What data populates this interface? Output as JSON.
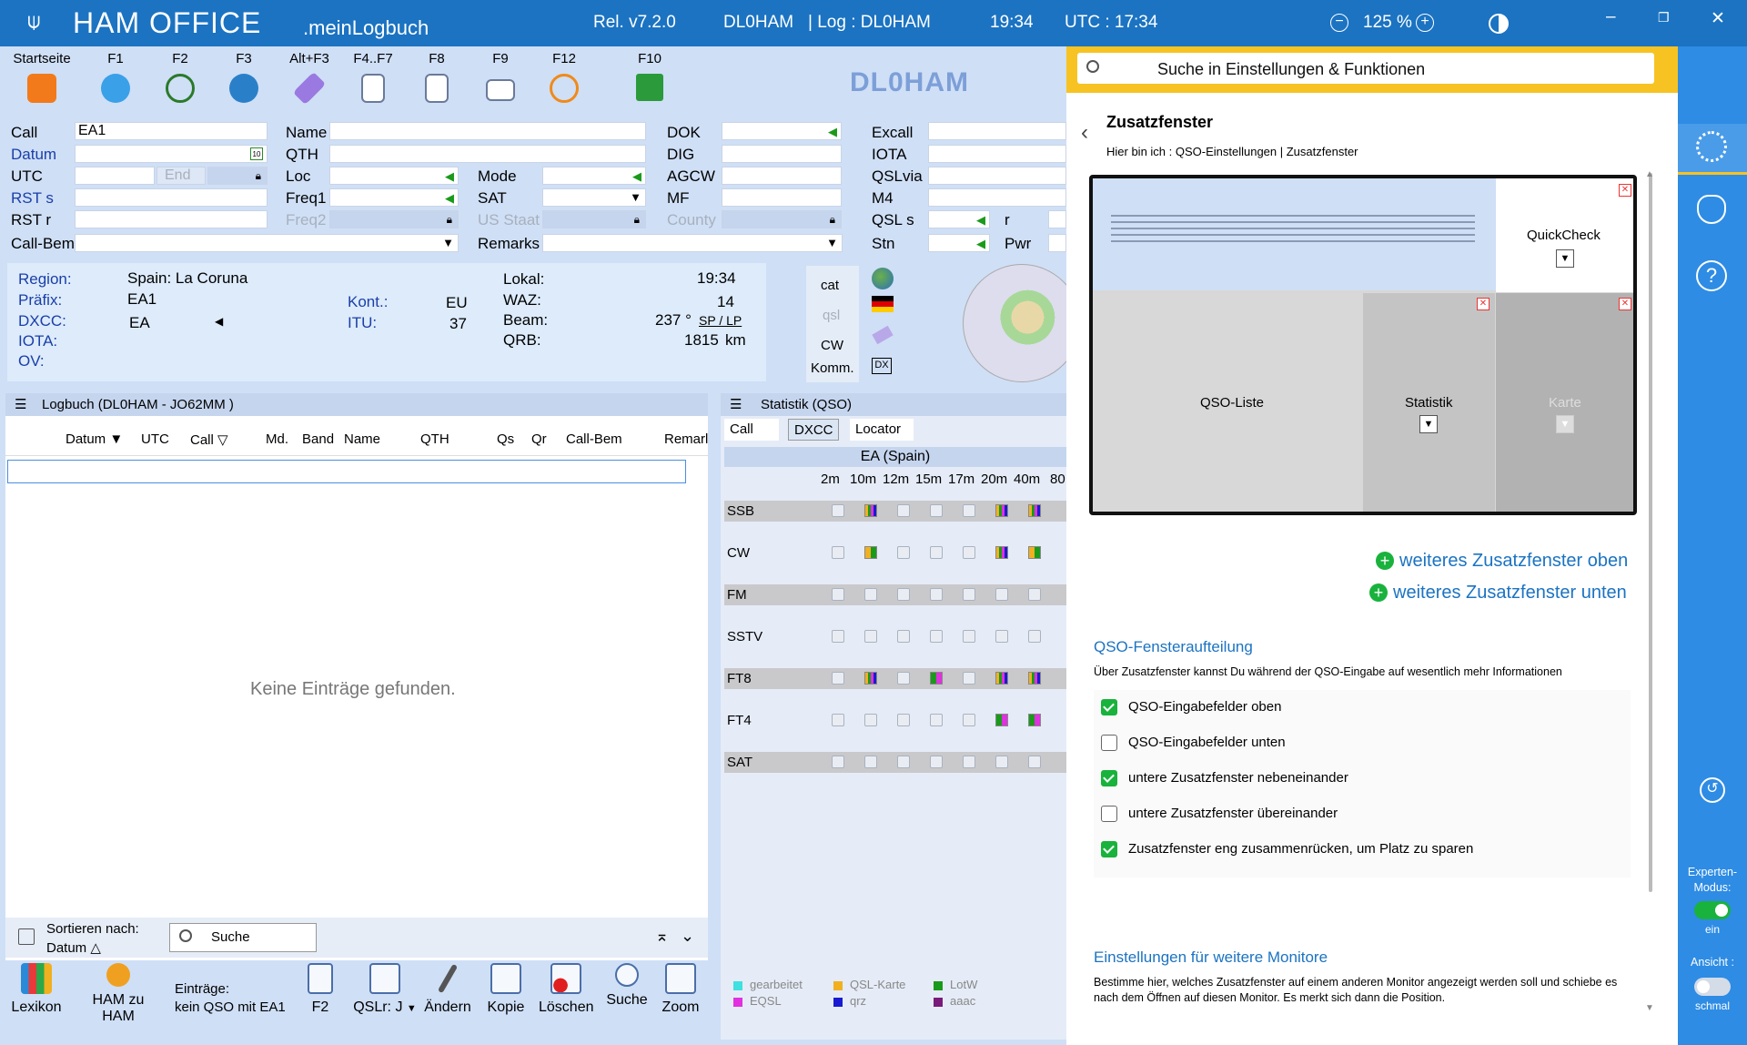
{
  "titlebar": {
    "app": "HAM OFFICE",
    "app_sub": ".meinLogbuch",
    "release": "Rel. v7.2.0",
    "station": "DL0HAM",
    "log": "|   Log : DL0HAM",
    "time": "19:34",
    "utc": "UTC : 17:34",
    "zoom": "125 %"
  },
  "toolbar": {
    "items": [
      {
        "key": "Startseite",
        "icon": "home-icon",
        "color": "#f27a1a"
      },
      {
        "key": "F1",
        "icon": "help-icon",
        "color": "#3aa0e8"
      },
      {
        "key": "F2",
        "icon": "clock-calendar-icon",
        "color": "#2a7a2a"
      },
      {
        "key": "F3",
        "icon": "globe-icon",
        "color": "#2a80c8"
      },
      {
        "key": "Alt+F3",
        "icon": "satellite-icon",
        "color": "#8a6ad0"
      },
      {
        "key": "F4..F7",
        "icon": "document-icon",
        "color": "#e07a2a"
      },
      {
        "key": "F8",
        "icon": "info-doc-icon",
        "color": "#3a8ad8"
      },
      {
        "key": "F9",
        "icon": "mail-plus-icon",
        "color": "#2aaa4a"
      },
      {
        "key": "F12",
        "icon": "sync-icon",
        "color": "#f08a1a"
      },
      {
        "key": "F10",
        "icon": "save-icon",
        "color": "#2a9a3a"
      }
    ],
    "callsign": "DL0HAM"
  },
  "form": {
    "call_label": "Call",
    "call_value": "EA1",
    "datum_label": "Datum",
    "utc_label": "UTC",
    "utc_end": "End",
    "rsts_label": "RST s",
    "rstr_label": "RST r",
    "callbem_label": "Call-Bem.",
    "name_label": "Name",
    "qth_label": "QTH",
    "loc_label": "Loc",
    "freq1_label": "Freq1",
    "freq2_label": "Freq2",
    "mode_label": "Mode",
    "sat_label": "SAT",
    "usstaat_label": "US Staat",
    "remarks_label": "Remarks",
    "dok_label": "DOK",
    "dig_label": "DIG",
    "agcw_label": "AGCW",
    "mf_label": "MF",
    "county_label": "County",
    "excall_label": "Excall",
    "iota_label": "IOTA",
    "qslvia_label": "QSLvia",
    "m4_label": "M4",
    "qsls_label": "QSL s",
    "r_label": "r",
    "stn_label": "Stn",
    "pwr_label": "Pwr"
  },
  "info": {
    "region_label": "Region:",
    "region": "Spain: La Coruna",
    "praefix_label": "Präfix:",
    "praefix": "EA1",
    "dxcc_label": "DXCC:",
    "dxcc": "EA",
    "iota_label": "IOTA:",
    "ov_label": "OV:",
    "kont_label": "Kont.:",
    "kont": "EU",
    "itu_label": "ITU:",
    "itu": "37",
    "lokal_label": "Lokal:",
    "lokal": "19:34",
    "waz_label": "WAZ:",
    "waz": "14",
    "beam_label": "Beam:",
    "beam": "237 °",
    "splp": "SP / LP",
    "qrb_label": "QRB:",
    "qrb": "1815",
    "qrb_unit": "km",
    "side": [
      "cat",
      "qsl",
      "CW",
      "Komm."
    ]
  },
  "logbook": {
    "title": "Logbuch  (DL0HAM - JO62MM )",
    "columns": [
      "Datum",
      "UTC",
      "Call",
      "Md.",
      "Band",
      "Name",
      "QTH",
      "Qs",
      "Qr",
      "Call-Bem",
      "Remarl"
    ],
    "empty": "Keine Einträge gefunden.",
    "sort_label": "Sortieren nach:",
    "sort_value": "Datum △",
    "search_placeholder": "Suche"
  },
  "stats": {
    "title": "Statistik (QSO)",
    "tabs": [
      "Call",
      "DXCC",
      "Locator"
    ],
    "country": "EA (Spain)",
    "bands": [
      "2m",
      "10m",
      "12m",
      "15m",
      "17m",
      "20m",
      "40m",
      "80"
    ],
    "modes": [
      "SSB",
      "CW",
      "FM",
      "SSTV",
      "FT8",
      "FT4",
      "SAT"
    ],
    "legend": [
      {
        "label": "gearbeitet",
        "color": "#3ee0e0"
      },
      {
        "label": "QSL-Karte",
        "color": "#f0b020"
      },
      {
        "label": "LotW",
        "color": "#1a9a1a"
      },
      {
        "label": "EQSL",
        "color": "#e030e0"
      },
      {
        "label": "qrz",
        "color": "#1a1ad0"
      },
      {
        "label": "aaac",
        "color": "#7a1a7a"
      }
    ]
  },
  "bottombar": {
    "lexikon": "Lexikon",
    "hamzuham": "HAM zu HAM",
    "eintraege_label": "Einträge:",
    "eintraege_value": "kein QSO mit EA1",
    "f2": "F2",
    "qslr": "QSLr: J",
    "aendern": "Ändern",
    "kopie": "Kopie",
    "loeschen": "Löschen",
    "suche": "Suche",
    "zoom": "Zoom"
  },
  "settings": {
    "search_placeholder": "Suche in Einstellungen & Funktionen",
    "title": "Zusatzfenster",
    "breadcrumb": "Hier bin ich : QSO-Einstellungen | Zusatzfenster",
    "preview": {
      "quickcheck": "QuickCheck",
      "qsoliste": "QSO-Liste",
      "statistik": "Statistik",
      "karte": "Karte"
    },
    "add_top": "weiteres Zusatzfenster oben",
    "add_bottom": "weiteres Zusatzfenster unten",
    "section1_title": "QSO-Fensteraufteilung",
    "section1_desc": "Über Zusatzfenster kannst Du während der QSO-Eingabe auf wesentlich mehr Informationen",
    "options": [
      {
        "label": "QSO-Eingabefelder oben",
        "checked": true
      },
      {
        "label": "QSO-Eingabefelder unten",
        "checked": false
      },
      {
        "label": "untere Zusatzfenster nebeneinander",
        "checked": true
      },
      {
        "label": "untere Zusatzfenster übereinander",
        "checked": false
      },
      {
        "label": "Zusatzfenster eng zusammenrücken, um Platz zu sparen",
        "checked": true
      }
    ],
    "section2_title": "Einstellungen für weitere Monitore",
    "section2_desc": "Bestimme hier, welches Zusatzfenster auf einem anderen Monitor angezeigt werden soll und schiebe es nach dem Öffnen auf diesen Monitor. Es merkt sich dann die Position."
  },
  "rail": {
    "expert_label": "Experten-Modus:",
    "expert_state": "ein",
    "view_label": "Ansicht :",
    "view_state": "schmal"
  }
}
